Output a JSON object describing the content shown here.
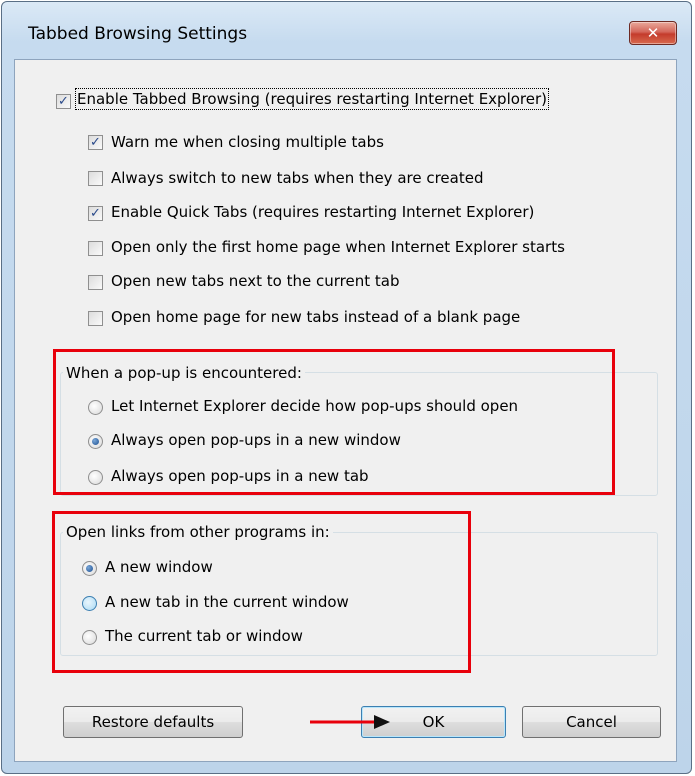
{
  "dialog": {
    "title": "Tabbed Browsing Settings",
    "close_label": "✕"
  },
  "main_option": {
    "label": "Enable Tabbed Browsing (requires restarting Internet Explorer)",
    "checked": true
  },
  "sub_options": [
    {
      "label": "Warn me when closing multiple tabs",
      "checked": true
    },
    {
      "label": "Always switch to new tabs when they are created",
      "checked": false
    },
    {
      "label": "Enable Quick Tabs (requires restarting Internet Explorer)",
      "checked": true
    },
    {
      "label": "Open only the first home page when Internet Explorer starts",
      "checked": false
    },
    {
      "label": "Open new tabs next to the current tab",
      "checked": false
    },
    {
      "label": "Open home page for new tabs instead of a blank page",
      "checked": false
    }
  ],
  "popup_group": {
    "legend": "When a pop-up is encountered:",
    "options": [
      {
        "label": "Let Internet Explorer decide how pop-ups should open",
        "selected": false
      },
      {
        "label": "Always open pop-ups in a new window",
        "selected": true
      },
      {
        "label": "Always open pop-ups in a new tab",
        "selected": false
      }
    ]
  },
  "links_group": {
    "legend": "Open links from other programs in:",
    "options": [
      {
        "label": "A new window",
        "selected": true
      },
      {
        "label": "A new tab in the current window",
        "selected": false
      },
      {
        "label": "The current tab or window",
        "selected": false
      }
    ]
  },
  "buttons": {
    "restore": "Restore defaults",
    "ok": "OK",
    "cancel": "Cancel"
  },
  "colors": {
    "highlight_box": "#e8000b",
    "annotation_arrow": "#e8000b"
  }
}
